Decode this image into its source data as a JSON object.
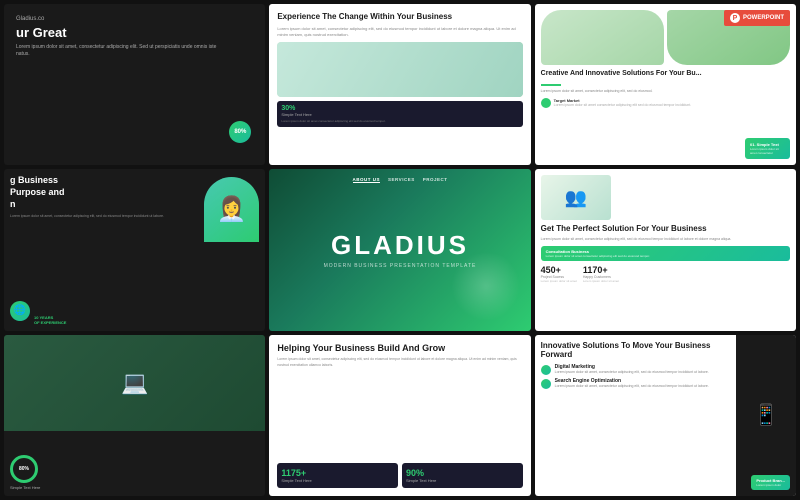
{
  "slides": [
    {
      "id": "slide-1",
      "partial_text": "ur Great",
      "small_text": "Lorem ipsum dolor sit amet, consectetur adipiscing elit. Sed ut perspiciatis unde omnis iste natus.",
      "badge_text": "80%"
    },
    {
      "id": "slide-2",
      "title": "Experience The Change Within Your Business",
      "body_text": "Lorem ipsum dolor sit amet, consectetur adipiscing elit, sed do eiusmod tempor incididunt ut labore et dolore magna aliqua. Ut enim ad minim veniam, quis nostrud exercitation.",
      "stat_num": "30%",
      "stat_label": "Simple Text Here",
      "stat_desc": "Lorem ipsum dolor sit amet consectetur adipiscing elit sed do eiusmod tempor."
    },
    {
      "id": "slide-3",
      "title": "Creative And Innovative Solutions For Your Bu...",
      "badge_label": "POWERPOINT",
      "body_text": "Lorem ipsum dolor sit amet, consectetur adipiscing elit, sed do eiusmod.",
      "target_label": "Target Market",
      "target_desc": "Lorem ipsum dolor sit amet consectetur adipiscing elit sed do eiusmod tempor incididunt.",
      "green_title": "01. Simple Text",
      "green_body": "Lorem ipsum dolor sit amet consectetur"
    },
    {
      "id": "slide-4",
      "partial_title": "g Business\nPurpose and\nn",
      "body_text": "Lorem ipsum dolor sit amet, consectetur adipiscing elit, sed do eiusmod tempor incididunt ut labore.",
      "years_label": "10 YEARS\nOF EXPERIENCE"
    },
    {
      "id": "slide-5",
      "nav_items": [
        "ABOUT US",
        "SERVICES",
        "PROJECT"
      ],
      "main_title": "GLADIUS",
      "subtitle": "MODERN BUSINESS PRESENTATION TEMPLATE"
    },
    {
      "id": "slide-6",
      "title": "Get The Perfect Solution For Your Business",
      "body_text": "Lorem ipsum dolor sit amet, consectetur adipiscing elit, sed do eiusmod tempor incididunt ut labore et dolore magna aliqua.",
      "consult_title": "Consultation Business",
      "consult_body": "Lorem ipsum dolor sit amet consectetur adipiscing elit sed do eiusmod tempor.",
      "stat1_num": "450+",
      "stat1_label": "Project Sucess",
      "stat1_desc": "Lorem ipsum dolor sit amet",
      "stat2_num": "1170+",
      "stat2_label": "Happy Customers",
      "stat2_desc": "Lorem ipsum dolor sit amet"
    },
    {
      "id": "slide-7",
      "circle_num": "80%",
      "simple_label": "Simple Text Here"
    },
    {
      "id": "slide-8",
      "title": "Helping Your Business Build And Grow",
      "body_text": "Lorem ipsum dolor sit amet, consectetur adipiscing elit, sed do eiusmod tempor incididunt ut labore et dolore magna aliqua. Ut enim ad minim veniam, quis nostrud exercitation ullamco laboris.",
      "stat1_num": "1175+",
      "stat1_label": "Simple Text Here",
      "stat2_num": "90%",
      "stat2_label": "Simple Text Here"
    },
    {
      "id": "slide-9",
      "title": "Innovative Solutions To Move Your Business Forward",
      "service1_name": "Digital Marketing",
      "service1_desc": "Lorem ipsum dolor sit amet, consectetur adipiscing elit, sed do eiusmod tempor incididunt ut labore.",
      "service2_name": "Search Engine Optimization",
      "service2_desc": "Lorem ipsum dolor sit amet, consectetur adipiscing elit, sed do eiusmod tempor incididunt ut labore.",
      "product_title": "Product Bran...",
      "product_desc": "Lorem ipsum dolor"
    }
  ],
  "colors": {
    "accent_green": "#2ecc71",
    "dark_bg": "#1a1a1a",
    "white": "#ffffff"
  }
}
